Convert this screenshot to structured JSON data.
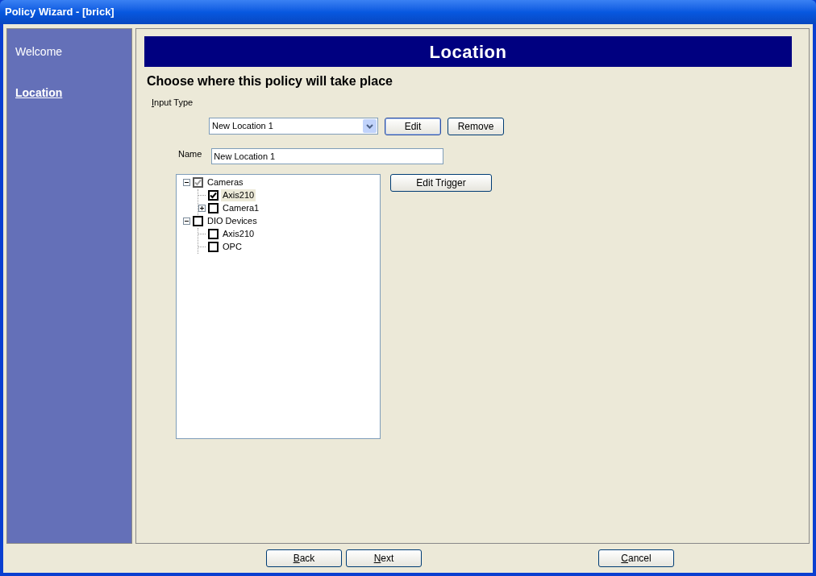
{
  "window": {
    "title": "Policy Wizard - [brick]"
  },
  "sidebar": {
    "items": [
      {
        "label": "Welcome",
        "selected": false
      },
      {
        "label": "Location",
        "selected": true
      }
    ]
  },
  "header": {
    "title": "Location"
  },
  "subtitle": "Choose where this policy will take place",
  "input_type": {
    "label": "Input Type",
    "value": "New Location 1"
  },
  "buttons": [
    {
      "label": "Edit",
      "default": true
    },
    {
      "label": "Remove",
      "default": false
    }
  ],
  "name_field": {
    "label": "Name",
    "value": "New Location 1"
  },
  "tree": [
    {
      "label": "Cameras",
      "checked": true,
      "greyed": true,
      "expanded": true,
      "selected": false,
      "children": [
        {
          "label": "Axis210",
          "checked": true,
          "greyed": false,
          "selected": true
        },
        {
          "label": "Camera1",
          "checked": false,
          "greyed": false,
          "expanded": false,
          "selected": false
        }
      ]
    },
    {
      "label": "DIO Devices",
      "checked": false,
      "greyed": false,
      "expanded": true,
      "selected": false,
      "children": [
        {
          "label": "Axis210",
          "checked": false,
          "greyed": false,
          "selected": false
        },
        {
          "label": "OPC",
          "checked": false,
          "greyed": false,
          "selected": false
        }
      ]
    }
  ],
  "edit_trigger": {
    "label": "Edit Trigger"
  },
  "footer_buttons": [
    {
      "label": "Back"
    },
    {
      "label": "Next"
    },
    {
      "label": "Cancel"
    }
  ]
}
